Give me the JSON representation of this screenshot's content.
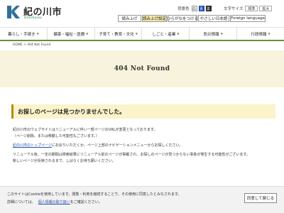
{
  "header": {
    "logo_text": "紀の川市",
    "logo_sub": "Kinokawa",
    "bg_color_label": "背景色",
    "bg_chips": [
      "白",
      "青",
      "黒"
    ],
    "font_size_label": "文字サイズ",
    "font_sizes": [
      "標準",
      "拡大"
    ],
    "links": [
      {
        "label": "読み上げ",
        "active": false
      },
      {
        "label": "読み上げ設定",
        "active": true
      },
      {
        "label": "ひらがなをつける",
        "active": false
      },
      {
        "label": "やさしい日本語",
        "active": false
      },
      {
        "label": "Foreign language",
        "active": false
      }
    ]
  },
  "nav": {
    "items": [
      "暮らし・手続き",
      "健康・福祉・医療",
      "子育て・教育・文化",
      "しごと・産業",
      "防災情報",
      "行政情報"
    ]
  },
  "breadcrumb": "HOME > 404 Not Found",
  "page_title": "404 Not Found",
  "message": "お探しのページは見つかりませんでした。",
  "body": {
    "line1": "紀の川市のウェブサイトはリニューアルに伴い一部ページのURLが変更となっております。",
    "line2": "（ページ削除、または移動した可能性もございます。）",
    "link_text": "紀の川市のトップページ",
    "line3_rest": "にお戻りいただくか、ページ上部のナビゲーションメニューからお探しください。",
    "line4": "リニューアル後、一定の期間は検索結果にリニューアル前のページが掲載され、お探しのページが見つからない事象が発生する可能性がございます。",
    "line5": "新しいページが反映されるまで、しばらくお待ち願いください。"
  },
  "cookie": {
    "line1": "このサイトはCookieを使用しています。閲覧・利用を継続することで、その使用に同意したとみなされます。",
    "line2": "詳細については、",
    "policy_link": "個人情報の取り扱い",
    "line2_rest": "をご確認ください。",
    "button_label": "同意して閉じる"
  },
  "colors": {
    "accent_green": "#6b8e3d",
    "title_band": "#f7f3dd",
    "message_bg": "#fbf3c9",
    "message_border": "#b78a14",
    "link_blue": "#1f4ea8"
  }
}
